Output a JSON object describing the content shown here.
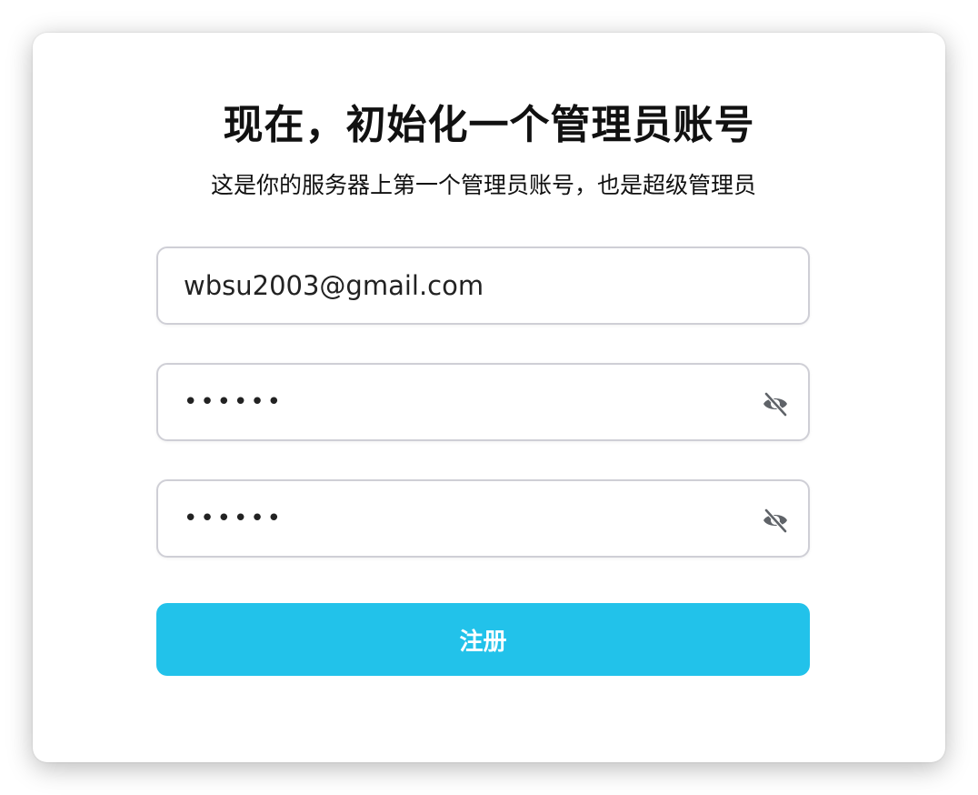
{
  "header": {
    "title": "现在，初始化一个管理员账号",
    "subtitle": "这是你的服务器上第一个管理员账号，也是超级管理员"
  },
  "form": {
    "email": {
      "value": "wbsu2003@gmail.com"
    },
    "password": {
      "value": "••••••",
      "toggle_icon": "eye-slash-icon"
    },
    "confirm_password": {
      "value": "••••••",
      "toggle_icon": "eye-slash-icon"
    },
    "submit_label": "注册"
  },
  "colors": {
    "accent": "#22c2ea",
    "border": "#cfcfd6",
    "icon": "#5f6368"
  }
}
